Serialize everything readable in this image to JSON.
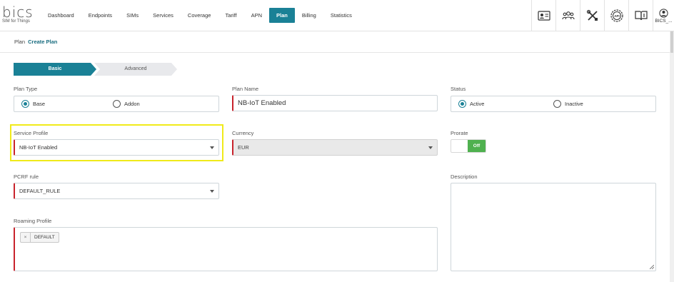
{
  "brand": {
    "logo_text": "bics",
    "tagline": "SIM for Things"
  },
  "nav": {
    "items": [
      "Dashboard",
      "Endpoints",
      "SIMs",
      "Services",
      "Coverage",
      "Tariff",
      "APN",
      "Plan",
      "Billing",
      "Statistics"
    ],
    "active": "Plan"
  },
  "top_icons": [
    "id-card-icon",
    "users-icon",
    "tools-icon",
    "api-icon",
    "book-icon"
  ],
  "user": {
    "name": "BICS_..."
  },
  "breadcrumb": {
    "root": "Plan",
    "current": "Create Plan"
  },
  "wizard": {
    "steps": [
      "Basic",
      "Advanced"
    ],
    "active": "Basic"
  },
  "form": {
    "plan_type": {
      "label": "Plan Type",
      "options": [
        "Base",
        "Addon"
      ],
      "selected": "Base"
    },
    "plan_name": {
      "label": "Plan Name",
      "value": "NB-IoT Enabled"
    },
    "status": {
      "label": "Status",
      "options": [
        "Active",
        "Inactive"
      ],
      "selected": "Active"
    },
    "service_profile": {
      "label": "Service Profile",
      "value": "NB-IoT Enabled"
    },
    "currency": {
      "label": "Currency",
      "value": "EUR"
    },
    "prorate": {
      "label": "Prorate",
      "value": "Off"
    },
    "pcrf_rule": {
      "label": "PCRF rule",
      "value": "DEFAULT_RULE"
    },
    "description": {
      "label": "Description",
      "value": ""
    },
    "roaming_profile": {
      "label": "Roaming Profile",
      "chips": [
        "DEFAULT"
      ],
      "remove_symbol": "×"
    }
  },
  "colors": {
    "accent": "#1a8196",
    "required": "#c8232c",
    "toggle_on": "#4fb14f",
    "highlight": "#f0ea1a"
  }
}
